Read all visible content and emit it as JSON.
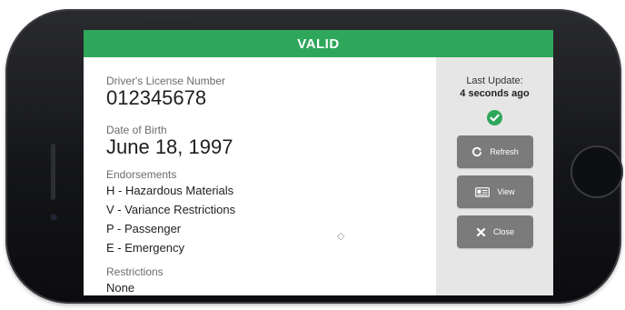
{
  "status": {
    "text": "VALID",
    "color": "#2ea75b"
  },
  "license": {
    "number_label": "Driver's License Number",
    "number": "012345678",
    "dob_label": "Date of Birth",
    "dob": "June 18, 1997",
    "endorsements_label": "Endorsements",
    "endorsements": [
      "H - Hazardous Materials",
      "V - Variance Restrictions",
      "P - Passenger",
      "E - Emergency"
    ],
    "restrictions_label": "Restrictions",
    "restrictions": "None"
  },
  "side": {
    "last_update_label": "Last Update:",
    "last_update_value": "4 seconds ago",
    "buttons": [
      {
        "label": "Refresh",
        "icon": "refresh-icon"
      },
      {
        "label": "View",
        "icon": "id-card-icon"
      },
      {
        "label": "Close",
        "icon": "close-icon"
      }
    ]
  },
  "colors": {
    "accent": "#2ea75b",
    "button": "#7b7b7b",
    "panel": "#e6e6e6"
  }
}
